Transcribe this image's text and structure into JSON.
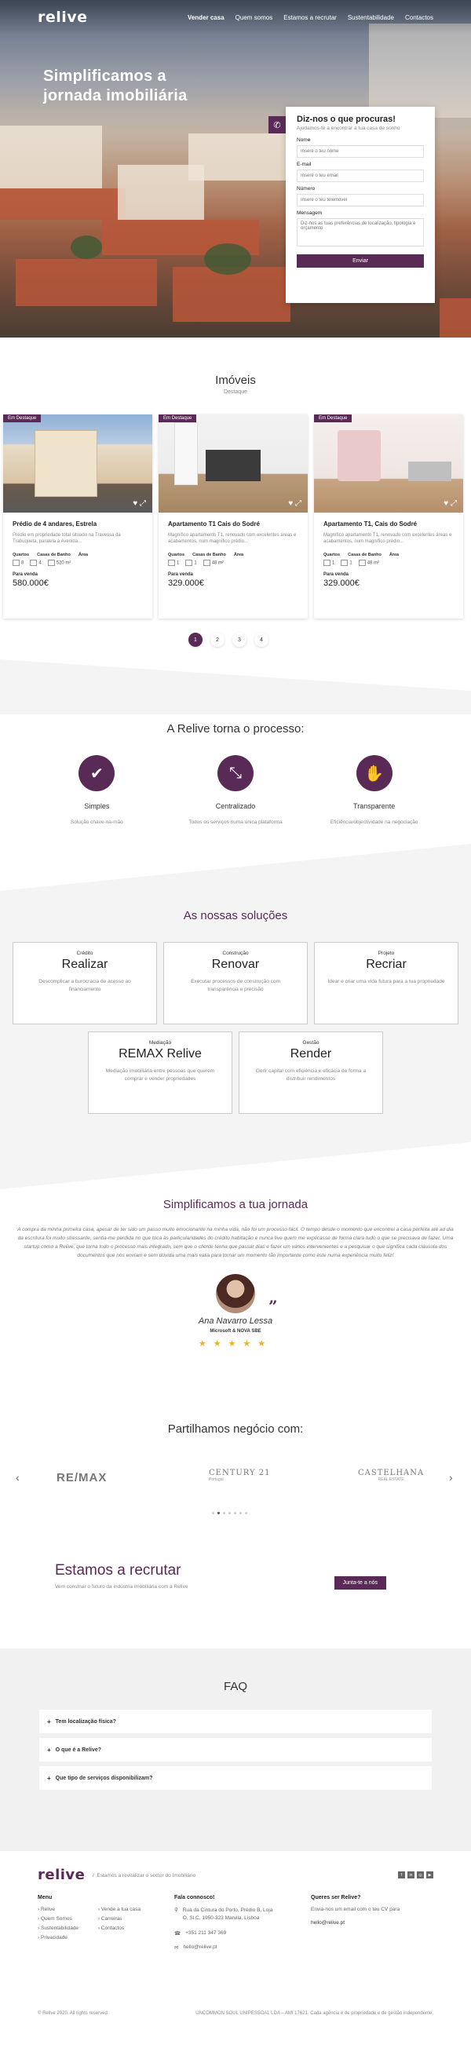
{
  "brand": {
    "logo": "relive",
    "accent": "#5a2a56"
  },
  "nav": {
    "items": [
      "Vender casa",
      "Quem somos",
      "Estamos a recrutar",
      "Sustentabilidade",
      "Contactos"
    ]
  },
  "hero": {
    "title": "Simplificamos a jornada imobiliária"
  },
  "contact_form": {
    "title": "Diz-nos o que procuras!",
    "subtitle": "Ajudamos-te a encontrar a tua casa de sonho",
    "name_label": "Nome",
    "name_placeholder": "Insere o teu nome",
    "email_label": "E-mail",
    "email_placeholder": "Insere o teu email",
    "phone_label": "Número",
    "phone_placeholder": "Insere o teu telemóvel",
    "message_label": "Mensagem",
    "message_placeholder": "Diz-nos as tuas preferências de localização, tipologia e orçamento",
    "submit": "Enviar"
  },
  "imoveis": {
    "title": "Imóveis",
    "subtitle": "Destaque",
    "items": [
      {
        "tag": "Em Destaque",
        "title": "Prédio de 4 andares, Estrela",
        "desc": "Prédio em propriedade total situado na Travessa da Trabuqueta, paralela à Avenida...",
        "h_quartos": "Quartos",
        "h_wc": "Casas de Banho",
        "h_area": "Área",
        "quartos": "8",
        "wc": "4",
        "area": "520",
        "unit": "m²",
        "venda": "Para venda",
        "price": "580.000€"
      },
      {
        "tag": "Em Destaque",
        "title": "Apartamento T1 Cais do Sodré",
        "desc": "Magnífico apartamento T1, renovado com excelentes áreas e acabamentos, num magnífico prédio...",
        "h_quartos": "Quartos",
        "h_wc": "Casas de Banho",
        "h_area": "Área",
        "quartos": "1",
        "wc": "1",
        "area": "48",
        "unit": "m²",
        "venda": "Para venda",
        "price": "329.000€"
      },
      {
        "tag": "Em Destaque",
        "title": "Apartamento T1, Cais do Sodré",
        "desc": "Magnífico apartamento T1, renovado com excelentes áreas e acabamentos, num magnífico prédio...",
        "h_quartos": "Quartos",
        "h_wc": "Casas de Banho",
        "h_area": "Área",
        "quartos": "1",
        "wc": "1",
        "area": "48",
        "unit": "m²",
        "venda": "Para venda",
        "price": "329.000€"
      }
    ],
    "pages": [
      "1",
      "2",
      "3",
      "4"
    ]
  },
  "processo": {
    "title": "A Relive torna o processo:",
    "items": [
      {
        "label": "Simples",
        "desc": "Solução chave-na-mão",
        "icon": "check-icon"
      },
      {
        "label": "Centralizado",
        "desc": "Todos os serviços numa única plataforma",
        "icon": "centralize-icon"
      },
      {
        "label": "Transparente",
        "desc": "Eficiência/objectividade na negociação",
        "icon": "handshake-icon"
      }
    ]
  },
  "solucoes": {
    "title": "As nossas soluções",
    "items": [
      {
        "cat": "Crédito",
        "name": "Realizar",
        "desc": "Descomplicar a burocracia de acesso ao financiamento"
      },
      {
        "cat": "Construção",
        "name": "Renovar",
        "desc": "Executar processos de construção com transparência e precisão"
      },
      {
        "cat": "Projeto",
        "name": "Recriar",
        "desc": "Idear e criar uma vida futura para a tua propriedade"
      },
      {
        "cat": "Mediação",
        "name": "REMAX Relive",
        "desc": "Mediação imobiliária entre pessoas que querem comprar e vender propriedades"
      },
      {
        "cat": "Gestão",
        "name": "Render",
        "desc": "Gerir capital com eficiência e eficácia de forma a distribuir rendimentos"
      }
    ]
  },
  "testemunho": {
    "title": "Simplificamos a tua jornada",
    "quote": "A compra da minha primeira casa, apesar de ter sido um passo muito emocionante na minha vida, não foi um processo fácil. O tempo desde o momento que encontrei a casa perfeita até ao dia da escritura foi muito stressante, sentia-me perdida no que toca às particularidades do crédito habitação e nunca tive quem me explicasse de forma clara tudo o que se precisava de fazer. Uma startup como a Relive, que torna todo o processo mais integrado, sem que o cliente tenha que passar dias e fazer um vários intervenientes e a pesquisar o que significa cada cláusula dos documentos que nos enviam e sem dúvida uma mais valia para tornar um momento tão importante como este numa experiência muito feliz!",
    "name": "Ana Navarro Lessa",
    "company": "Microsoft & NOVA SBE",
    "rating": 5
  },
  "parceiros": {
    "title": "Partilhamos negócio com:",
    "logos": [
      "RE/MAX",
      "CENTURY 21",
      "CASTELHANA"
    ],
    "logo_subs": [
      "",
      "Portugal",
      "REAL ESTATE"
    ]
  },
  "recrutar": {
    "title": "Estamos a recrutar",
    "subtitle": "Vem construir o futuro da indústria imobiliária com a Relive",
    "button": "Junta-te a nós"
  },
  "faq": {
    "title": "FAQ",
    "items": [
      "Tem localização física?",
      "O que é a Relive?",
      "Que tipo de serviços disponibilizam?"
    ]
  },
  "footer": {
    "tagline": "Estamos a revitalizar o sector do Imobiliário",
    "menu_title": "Menu",
    "menu_col1": [
      "Relive",
      "Quem Somos",
      "Sustentabilidade",
      "Privacidade"
    ],
    "menu_col2": [
      "Vende a tua casa",
      "Carreiras",
      "Contactos"
    ],
    "contact_title": "Fala connosco!",
    "address": "Rua da Cintura do Porto, Prédio B, Loja O, Sl.C, 1950-323 Marvila, Lisboa",
    "phone": "+351 211 347 369",
    "email": "hello@relive.pt",
    "join_title": "Queres ser Relive?",
    "join_text": "Envia-nos um email com o teu CV para",
    "join_email": "hello@relive.pt",
    "copyright": "© Relive 2020. All rights reserved.",
    "legal": "UNCOMMON SOUL UNIPESSOAL LDA – AMI 17621. Cada agência é de propriedade e de gestão independente."
  }
}
